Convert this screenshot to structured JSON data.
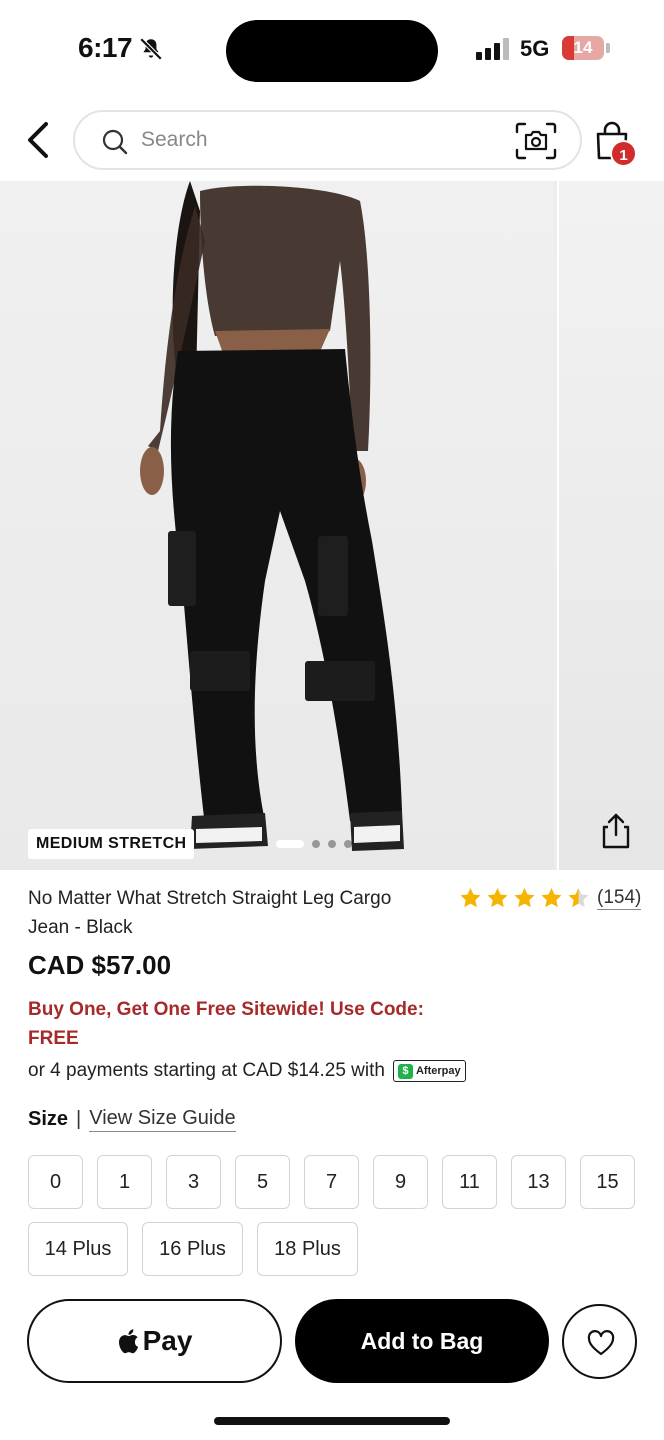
{
  "status_bar": {
    "time": "6:17",
    "network": "5G",
    "battery": "14"
  },
  "header": {
    "search_placeholder": "Search",
    "bag_count": "1"
  },
  "gallery": {
    "stretch_tag": "MEDIUM STRETCH",
    "dot_count": 4,
    "active_dot": 0
  },
  "product": {
    "title": "No Matter What Stretch Straight Leg Cargo Jean - Black",
    "rating": 4.5,
    "review_count": "(154)",
    "price": "CAD $57.00",
    "promo": "Buy One, Get One Free Sitewide! Use Code: FREE",
    "installments": "or 4 payments starting at CAD $14.25 with",
    "afterpay_label": "Afterpay"
  },
  "size": {
    "label": "Size",
    "separator": "|",
    "guide_link": "View Size Guide",
    "options": [
      "0",
      "1",
      "3",
      "5",
      "7",
      "9",
      "11",
      "13",
      "15",
      "14 Plus",
      "16 Plus",
      "18 Plus"
    ]
  },
  "actions": {
    "apple_pay_label": "Pay",
    "add_to_bag_label": "Add to Bag"
  },
  "colors": {
    "promo": "#a62a2a",
    "star": "#f5b400",
    "badge": "#d12b2b",
    "afterpay": "#1fb24a"
  }
}
